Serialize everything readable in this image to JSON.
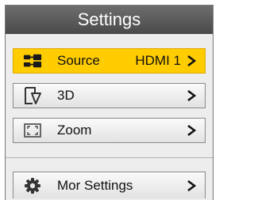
{
  "header": {
    "title": "Settings"
  },
  "menu": {
    "source": {
      "label": "Source",
      "value": "HDMI 1",
      "icon": "input-source-icon"
    },
    "threed": {
      "label": "3D",
      "icon": "3d-icon"
    },
    "zoom": {
      "label": "Zoom",
      "icon": "zoom-frame-icon"
    },
    "more": {
      "label": "Mor Settings",
      "icon": "gear-icon"
    }
  },
  "colors": {
    "selected": "#ffcc00",
    "header": "#5a5a5a"
  }
}
